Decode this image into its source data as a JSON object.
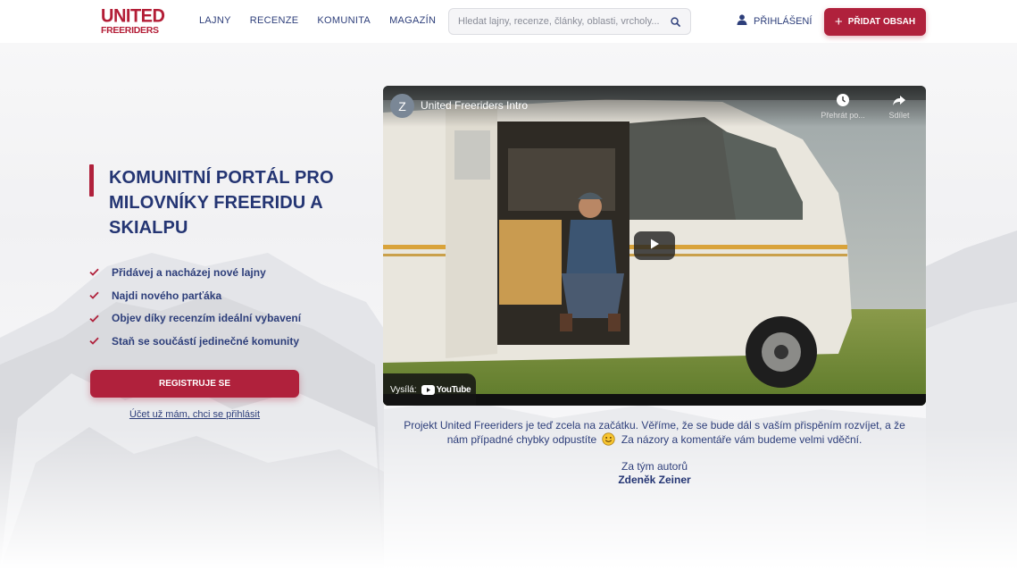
{
  "header": {
    "logo_line1": "UNITED",
    "logo_line2": "FREERIDERS",
    "nav": [
      "LAJNY",
      "RECENZE",
      "KOMUNITA",
      "MAGAZÍN"
    ],
    "search_placeholder": "Hledat lajny, recenze, články, oblasti, vrcholy...",
    "login_label": "PŘIHLÁŠENÍ",
    "add_label": "PŘIDAT OBSAH"
  },
  "hero": {
    "title": "KOMUNITNÍ PORTÁL PRO MILOVNÍKY FREERIDU A SKIALPU",
    "features": [
      "Přidávej a nacházej nové lajny",
      "Najdi nového parťáka",
      "Objev díky recenzím ideální vybavení",
      "Staň se součástí jedinečné komunity"
    ],
    "register_label": "REGISTRUJE SE",
    "have_account_label": "Účet už mám, chci se přihlásit"
  },
  "video": {
    "avatar_letter": "Z",
    "title": "United Freeriders Intro",
    "watch_later": "Přehrát po...",
    "share": "Sdílet",
    "broadcast_by": "Vysílá:",
    "youtube": "YouTube"
  },
  "caption": {
    "text_before": "Projekt United Freeriders je teď zcela na začátku. Věříme, že se bude dál s vaším přispěním rozvíjet, a že nám případné chybky odpustíte",
    "text_after": "Za názory a komentáře vám budeme velmi vděční.",
    "sign_line1": "Za tým autorů",
    "sign_line2": "Zdeněk Zeiner"
  },
  "colors": {
    "brand_red": "#b0213c",
    "brand_navy": "#243573"
  }
}
